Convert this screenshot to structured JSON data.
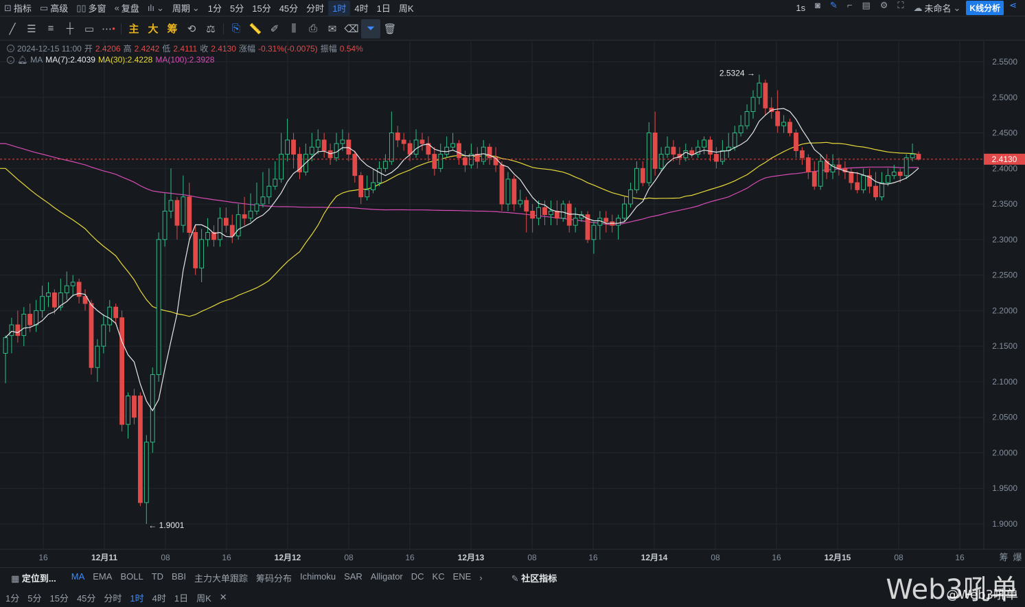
{
  "toolbar": {
    "indicator": "指标",
    "advanced": "高级",
    "multi_window": "多窗",
    "restore": "复盘",
    "period": "周期",
    "timeframes": [
      "1分",
      "5分",
      "15分",
      "45分",
      "分时",
      "1时",
      "4时",
      "1日",
      "周K"
    ],
    "active_timeframe": "1时",
    "interval": "1s",
    "unnamed": "未命名",
    "kline_analysis": "K线分析"
  },
  "draw_tools": {
    "main_label": "主",
    "big_label": "大",
    "chip_label": "筹"
  },
  "legend": {
    "datetime": "2024-12-15 11:00",
    "open_label": "开",
    "open": "2.4206",
    "high_label": "高",
    "high": "2.4242",
    "low_label": "低",
    "low": "2.4111",
    "close_label": "收",
    "close": "2.4130",
    "change_label": "涨幅",
    "change": "-0.31%(-0.0075)",
    "amp_label": "振幅",
    "amplitude": "0.54%",
    "ma_label": "MA",
    "ma7": "MA(7):2.4039",
    "ma30": "MA(30):2.4228",
    "ma100": "MA(100):2.3928"
  },
  "chart_data": {
    "type": "candlestick",
    "y_ticks": [
      "2.5500",
      "2.5000",
      "2.4500",
      "2.4000",
      "2.3500",
      "2.3000",
      "2.2500",
      "2.2000",
      "2.1500",
      "2.1000",
      "2.0500",
      "2.0000",
      "1.9500",
      "1.9000"
    ],
    "ylim": [
      1.88,
      2.57
    ],
    "x_ticks": [
      "16",
      "12月11",
      "08",
      "16",
      "12月12",
      "08",
      "16",
      "12月13",
      "08",
      "16",
      "12月14",
      "08",
      "16",
      "12月15",
      "08",
      "16"
    ],
    "last_price": "2.4130",
    "high_annotation": "2.5324",
    "low_annotation": "1.9001",
    "colors": {
      "up": "#2ebd85",
      "down": "#e24a4a",
      "ma7": "#e6e8ea",
      "ma30": "#e8d93a",
      "ma100": "#d84bb6",
      "price_tag": "#e24a4a"
    },
    "candles": [
      [
        2.14,
        2.162,
        2.098,
        2.165
      ],
      [
        2.165,
        2.18,
        2.14,
        2.19
      ],
      [
        2.18,
        2.165,
        2.155,
        2.2
      ],
      [
        2.165,
        2.195,
        2.15,
        2.205
      ],
      [
        2.195,
        2.18,
        2.17,
        2.21
      ],
      [
        2.18,
        2.2,
        2.17,
        2.215
      ],
      [
        2.2,
        2.22,
        2.19,
        2.235
      ],
      [
        2.22,
        2.225,
        2.205,
        2.24
      ],
      [
        2.225,
        2.205,
        2.195,
        2.23
      ],
      [
        2.205,
        2.225,
        2.2,
        2.245
      ],
      [
        2.225,
        2.235,
        2.215,
        2.255
      ],
      [
        2.235,
        2.24,
        2.22,
        2.25
      ],
      [
        2.24,
        2.22,
        2.21,
        2.245
      ],
      [
        2.22,
        2.21,
        2.2,
        2.23
      ],
      [
        2.21,
        2.12,
        2.11,
        2.215
      ],
      [
        2.12,
        2.15,
        2.1,
        2.16
      ],
      [
        2.15,
        2.18,
        2.14,
        2.195
      ],
      [
        2.18,
        2.205,
        2.17,
        2.215
      ],
      [
        2.205,
        2.19,
        2.18,
        2.21
      ],
      [
        2.19,
        2.04,
        2.03,
        2.2
      ],
      [
        2.04,
        2.08,
        2.02,
        2.085
      ],
      [
        2.08,
        2.05,
        2.04,
        2.09
      ],
      [
        2.08,
        1.93,
        1.925,
        2.085
      ],
      [
        1.93,
        2.015,
        1.9,
        2.025
      ],
      [
        2.015,
        2.11,
        2.0,
        2.12
      ],
      [
        2.11,
        2.3,
        2.1,
        2.31
      ],
      [
        2.3,
        2.34,
        2.29,
        2.365
      ],
      [
        2.34,
        2.355,
        2.33,
        2.4
      ],
      [
        2.355,
        2.32,
        2.3,
        2.36
      ],
      [
        2.32,
        2.36,
        2.31,
        2.39
      ],
      [
        2.36,
        2.31,
        2.3,
        2.38
      ],
      [
        2.31,
        2.26,
        2.25,
        2.32
      ],
      [
        2.26,
        2.3,
        2.24,
        2.315
      ],
      [
        2.3,
        2.31,
        2.29,
        2.33
      ],
      [
        2.31,
        2.3,
        2.29,
        2.32
      ],
      [
        2.3,
        2.33,
        2.29,
        2.345
      ],
      [
        2.33,
        2.32,
        2.31,
        2.345
      ],
      [
        2.32,
        2.305,
        2.295,
        2.335
      ],
      [
        2.305,
        2.335,
        2.3,
        2.35
      ],
      [
        2.335,
        2.33,
        2.32,
        2.36
      ],
      [
        2.33,
        2.34,
        2.325,
        2.365
      ],
      [
        2.34,
        2.35,
        2.335,
        2.38
      ],
      [
        2.35,
        2.36,
        2.345,
        2.395
      ],
      [
        2.36,
        2.375,
        2.35,
        2.4
      ],
      [
        2.375,
        2.385,
        2.37,
        2.41
      ],
      [
        2.385,
        2.42,
        2.38,
        2.45
      ],
      [
        2.42,
        2.44,
        2.41,
        2.47
      ],
      [
        2.44,
        2.42,
        2.4,
        2.45
      ],
      [
        2.42,
        2.395,
        2.385,
        2.43
      ],
      [
        2.395,
        2.42,
        2.39,
        2.435
      ],
      [
        2.42,
        2.43,
        2.41,
        2.45
      ],
      [
        2.43,
        2.44,
        2.42,
        2.455
      ],
      [
        2.44,
        2.425,
        2.415,
        2.45
      ],
      [
        2.425,
        2.415,
        2.405,
        2.435
      ],
      [
        2.415,
        2.435,
        2.41,
        2.45
      ],
      [
        2.435,
        2.44,
        2.425,
        2.455
      ],
      [
        2.44,
        2.42,
        2.41,
        2.45
      ],
      [
        2.42,
        2.39,
        2.38,
        2.425
      ],
      [
        2.39,
        2.36,
        2.35,
        2.395
      ],
      [
        2.36,
        2.37,
        2.355,
        2.39
      ],
      [
        2.37,
        2.38,
        2.365,
        2.4
      ],
      [
        2.38,
        2.4,
        2.375,
        2.41
      ],
      [
        2.4,
        2.41,
        2.395,
        2.42
      ],
      [
        2.41,
        2.45,
        2.405,
        2.48
      ],
      [
        2.45,
        2.44,
        2.43,
        2.46
      ],
      [
        2.44,
        2.435,
        2.425,
        2.45
      ],
      [
        2.435,
        2.42,
        2.41,
        2.44
      ],
      [
        2.42,
        2.44,
        2.415,
        2.455
      ],
      [
        2.44,
        2.435,
        2.425,
        2.45
      ],
      [
        2.435,
        2.42,
        2.41,
        2.445
      ],
      [
        2.42,
        2.4,
        2.39,
        2.43
      ],
      [
        2.4,
        2.42,
        2.395,
        2.435
      ],
      [
        2.42,
        2.43,
        2.415,
        2.445
      ],
      [
        2.43,
        2.435,
        2.425,
        2.45
      ],
      [
        2.435,
        2.415,
        2.405,
        2.44
      ],
      [
        2.415,
        2.405,
        2.395,
        2.425
      ],
      [
        2.405,
        2.42,
        2.4,
        2.435
      ],
      [
        2.42,
        2.41,
        2.4,
        2.43
      ],
      [
        2.41,
        2.43,
        2.405,
        2.44
      ],
      [
        2.43,
        2.415,
        2.405,
        2.435
      ],
      [
        2.415,
        2.405,
        2.395,
        2.43
      ],
      [
        2.405,
        2.35,
        2.34,
        2.41
      ],
      [
        2.35,
        2.385,
        2.34,
        2.395
      ],
      [
        2.385,
        2.35,
        2.34,
        2.39
      ],
      [
        2.35,
        2.355,
        2.345,
        2.37
      ],
      [
        2.355,
        2.34,
        2.31,
        2.36
      ],
      [
        2.34,
        2.33,
        2.31,
        2.35
      ],
      [
        2.33,
        2.345,
        2.32,
        2.355
      ],
      [
        2.345,
        2.335,
        2.32,
        2.355
      ],
      [
        2.335,
        2.34,
        2.32,
        2.355
      ],
      [
        2.34,
        2.33,
        2.32,
        2.355
      ],
      [
        2.33,
        2.35,
        2.325,
        2.355
      ],
      [
        2.35,
        2.32,
        2.31,
        2.355
      ],
      [
        2.32,
        2.33,
        2.31,
        2.345
      ],
      [
        2.33,
        2.335,
        2.325,
        2.34
      ],
      [
        2.335,
        2.3,
        2.295,
        2.34
      ],
      [
        2.3,
        2.32,
        2.28,
        2.325
      ],
      [
        2.32,
        2.33,
        2.3,
        2.34
      ],
      [
        2.33,
        2.325,
        2.31,
        2.34
      ],
      [
        2.325,
        2.32,
        2.31,
        2.335
      ],
      [
        2.32,
        2.33,
        2.3,
        2.335
      ],
      [
        2.33,
        2.35,
        2.325,
        2.36
      ],
      [
        2.35,
        2.37,
        2.345,
        2.38
      ],
      [
        2.37,
        2.4,
        2.365,
        2.41
      ],
      [
        2.4,
        2.38,
        2.375,
        2.41
      ],
      [
        2.38,
        2.45,
        2.375,
        2.465
      ],
      [
        2.45,
        2.4,
        2.39,
        2.48
      ],
      [
        2.4,
        2.42,
        2.395,
        2.43
      ],
      [
        2.42,
        2.43,
        2.415,
        2.445
      ],
      [
        2.43,
        2.42,
        2.41,
        2.44
      ],
      [
        2.42,
        2.415,
        2.405,
        2.43
      ],
      [
        2.415,
        2.425,
        2.41,
        2.435
      ],
      [
        2.425,
        2.42,
        2.415,
        2.43
      ],
      [
        2.42,
        2.43,
        2.415,
        2.44
      ],
      [
        2.43,
        2.44,
        2.42,
        2.445
      ],
      [
        2.44,
        2.42,
        2.41,
        2.445
      ],
      [
        2.42,
        2.41,
        2.4,
        2.43
      ],
      [
        2.41,
        2.425,
        2.405,
        2.44
      ],
      [
        2.425,
        2.43,
        2.415,
        2.45
      ],
      [
        2.43,
        2.45,
        2.425,
        2.46
      ],
      [
        2.45,
        2.46,
        2.445,
        2.475
      ],
      [
        2.46,
        2.48,
        2.455,
        2.49
      ],
      [
        2.48,
        2.5,
        2.47,
        2.51
      ],
      [
        2.5,
        2.52,
        2.49,
        2.532
      ],
      [
        2.52,
        2.485,
        2.475,
        2.525
      ],
      [
        2.485,
        2.48,
        2.47,
        2.5
      ],
      [
        2.48,
        2.46,
        2.45,
        2.51
      ],
      [
        2.46,
        2.465,
        2.45,
        2.475
      ],
      [
        2.465,
        2.45,
        2.445,
        2.47
      ],
      [
        2.45,
        2.425,
        2.415,
        2.455
      ],
      [
        2.425,
        2.415,
        2.405,
        2.43
      ],
      [
        2.415,
        2.395,
        2.385,
        2.42
      ],
      [
        2.395,
        2.375,
        2.37,
        2.41
      ],
      [
        2.375,
        2.41,
        2.37,
        2.42
      ],
      [
        2.41,
        2.395,
        2.385,
        2.42
      ],
      [
        2.395,
        2.405,
        2.385,
        2.42
      ],
      [
        2.405,
        2.4,
        2.39,
        2.415
      ],
      [
        2.4,
        2.395,
        2.385,
        2.41
      ],
      [
        2.395,
        2.38,
        2.37,
        2.4
      ],
      [
        2.38,
        2.37,
        2.365,
        2.395
      ],
      [
        2.37,
        2.39,
        2.365,
        2.4
      ],
      [
        2.39,
        2.375,
        2.365,
        2.4
      ],
      [
        2.375,
        2.36,
        2.355,
        2.395
      ],
      [
        2.36,
        2.38,
        2.355,
        2.395
      ],
      [
        2.38,
        2.39,
        2.375,
        2.4
      ],
      [
        2.39,
        2.395,
        2.385,
        2.405
      ],
      [
        2.395,
        2.39,
        2.38,
        2.4
      ],
      [
        2.39,
        2.415,
        2.385,
        2.42
      ],
      [
        2.415,
        2.42,
        2.41,
        2.435
      ],
      [
        2.42,
        2.413,
        2.411,
        2.424
      ]
    ]
  },
  "indicators": {
    "locate": "定位到...",
    "items": [
      "MA",
      "EMA",
      "BOLL",
      "TD",
      "BBI",
      "主力大单跟踪",
      "筹码分布",
      "Ichimoku",
      "SAR",
      "Alligator",
      "DC",
      "KC",
      "ENE"
    ],
    "active": "MA",
    "community": "社区指标"
  },
  "bottom_timeframes": [
    "1分",
    "5分",
    "15分",
    "45分",
    "分时",
    "1时",
    "4时",
    "1日",
    "周K"
  ],
  "bottom_active": "1时",
  "side_labels": {
    "chips": "筹",
    "burst": "爆"
  },
  "watermark": {
    "main": "Web3吼单",
    "sub": "@Web3吼单"
  }
}
